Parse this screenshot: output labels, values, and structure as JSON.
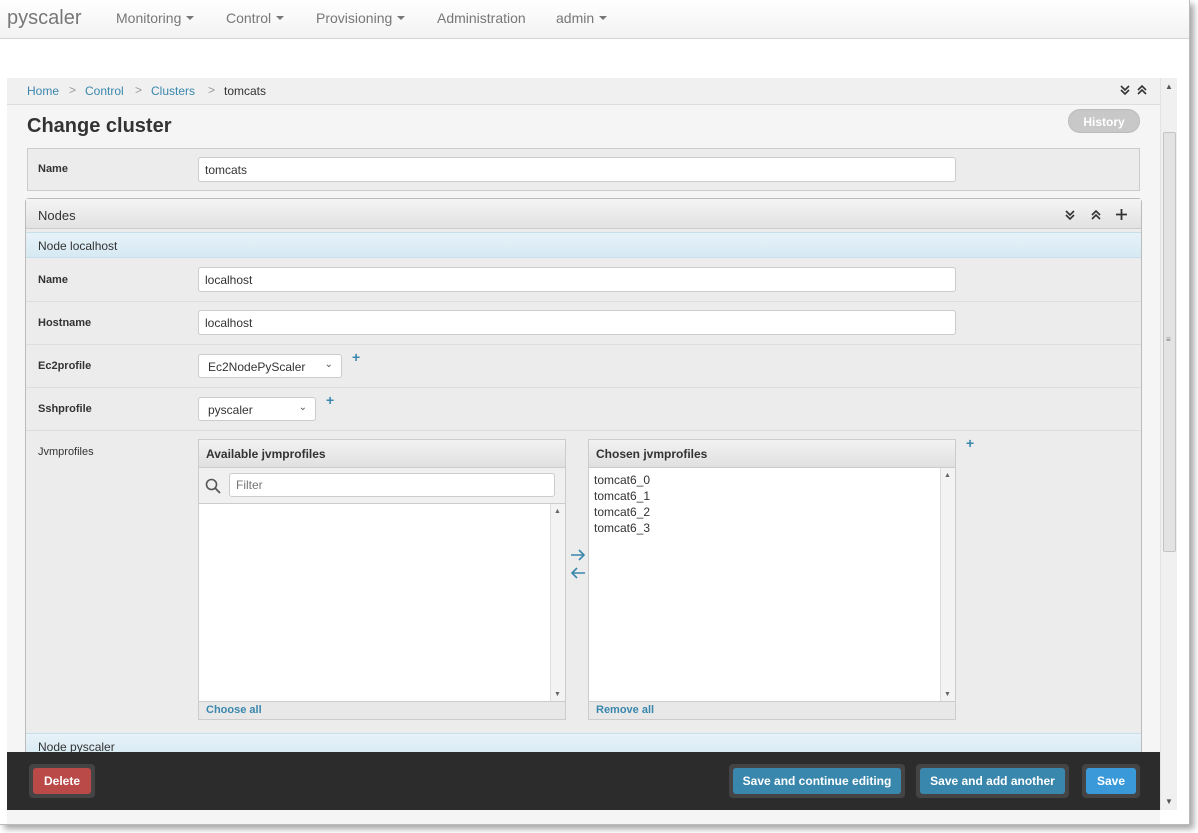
{
  "navbar": {
    "brand": "pyscaler",
    "items": [
      {
        "label": "Monitoring",
        "dropdown": true
      },
      {
        "label": "Control",
        "dropdown": true
      },
      {
        "label": "Provisioning",
        "dropdown": true
      },
      {
        "label": "Administration",
        "dropdown": false
      },
      {
        "label": "admin",
        "dropdown": true
      }
    ]
  },
  "breadcrumb": {
    "items": [
      "Home",
      "Control",
      "Clusters"
    ],
    "current": "tomcats",
    "separator": ">"
  },
  "page": {
    "title": "Change cluster",
    "history_label": "History"
  },
  "cluster": {
    "name_label": "Name",
    "name_value": "tomcats"
  },
  "nodes": {
    "section_title": "Nodes",
    "node_title": "Node localhost",
    "name_label": "Name",
    "name_value": "localhost",
    "hostname_label": "Hostname",
    "hostname_value": "localhost",
    "ec2profile_label": "Ec2profile",
    "ec2profile_value": "Ec2NodePyScaler",
    "sshprofile_label": "Sshprofile",
    "sshprofile_value": "pyscaler",
    "jvmprofiles_label": "Jvmprofiles",
    "available_title": "Available jvmprofiles",
    "filter_placeholder": "Filter",
    "choose_all": "Choose all",
    "chosen_title": "Chosen jvmprofiles",
    "chosen_items": [
      "tomcat6_0",
      "tomcat6_1",
      "tomcat6_2",
      "tomcat6_3"
    ],
    "remove_all": "Remove all",
    "next_node_title": "Node pyscaler"
  },
  "actions": {
    "delete": "Delete",
    "save_continue": "Save and continue editing",
    "save_add": "Save and add another",
    "save": "Save"
  },
  "colors": {
    "link": "#3a87ad",
    "delete": "#b94a48",
    "primary": "#3a9ad9",
    "secondary": "#3a87ad"
  }
}
